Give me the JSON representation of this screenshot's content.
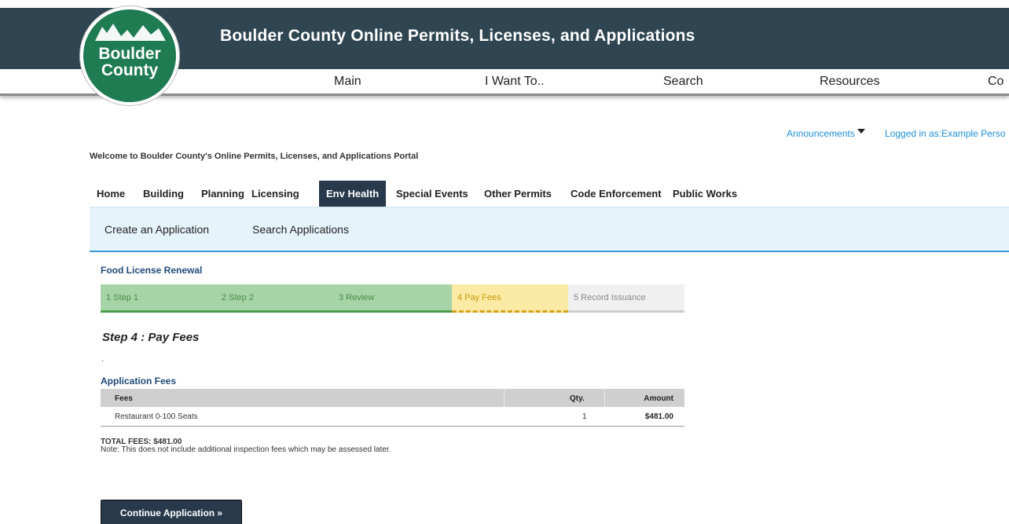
{
  "header": {
    "logo": {
      "line1": "Boulder",
      "line2": "County"
    },
    "title": "Boulder County Online Permits, Licenses, and Applications"
  },
  "top_nav": [
    "Main",
    "I Want To..",
    "Search",
    "Resources",
    "Co"
  ],
  "utility": {
    "announcements": "Announcements",
    "logged_in": "Logged in as:Example Perso"
  },
  "welcome": "Welcome to Boulder County's Online Permits, Licenses, and Applications Portal",
  "tabs": [
    "Home",
    "Building",
    "Planning",
    "Licensing",
    "Env Health",
    "Special Events",
    "Other Permits",
    "Code Enforcement",
    "Public Works"
  ],
  "active_tab": "Env Health",
  "sub_links": [
    "Create an Application",
    "Search Applications"
  ],
  "record_title": "Food License Renewal",
  "steps": [
    {
      "label": "1  Step 1",
      "state": "done"
    },
    {
      "label": "2  Step 2",
      "state": "done"
    },
    {
      "label": "3  Review",
      "state": "done"
    },
    {
      "label": "4  Pay Fees",
      "state": "current"
    },
    {
      "label": "5  Record Issuance",
      "state": "todo"
    }
  ],
  "step_heading": "Step 4 : Pay Fees",
  "dot": ".",
  "fees": {
    "title": "Application Fees",
    "headers": {
      "fees": "Fees",
      "qty": "Qty.",
      "amount": "Amount"
    },
    "rows": [
      {
        "fee": "Restaurant 0-100 Seats",
        "qty": "1",
        "amount": "$481.00"
      }
    ],
    "total": "TOTAL FEES: $481.00",
    "note": "Note: This does not include additional inspection fees which may be assessed later."
  },
  "continue_label": "Continue Application »",
  "colors": {
    "banner": "#2f4552",
    "logo_green": "#1e7b52",
    "tab_active": "#27394a",
    "link_blue": "#1c8fd6",
    "step_done": "#a6d4a6",
    "step_current": "#fbeaa3"
  }
}
